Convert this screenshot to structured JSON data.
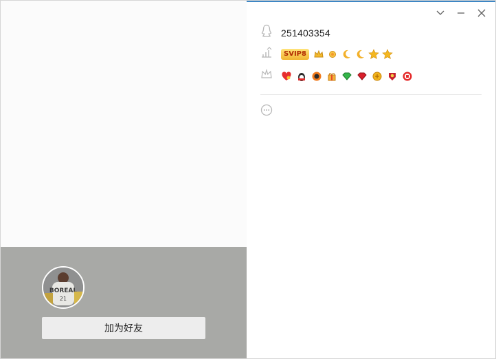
{
  "window": {
    "controls": {
      "dropdown": "chevron-down",
      "minimize": "minimize",
      "close": "close"
    }
  },
  "profile": {
    "qq_number": "251403354",
    "svip_label": "SVIP8",
    "add_friend_label": "加为好友",
    "accent_color": "#3d86c4"
  },
  "level_icons": [
    "crown-icon",
    "sun-icon",
    "moon-icon",
    "moon-icon",
    "star-icon",
    "star-icon"
  ],
  "service_icons": [
    "heart-badge-icon",
    "penguin-badge-icon",
    "qq-show-icon",
    "gift-badge-icon",
    "green-diamond-icon",
    "red-diamond-icon",
    "yellow-diamond-icon",
    "game-badge-icon",
    "video-badge-icon"
  ]
}
